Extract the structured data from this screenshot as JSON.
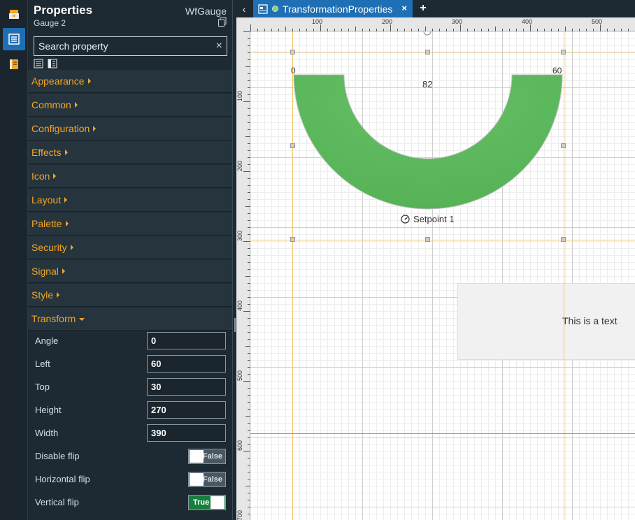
{
  "sidebar_icons": [
    {
      "name": "toolbox-icon",
      "active": false
    },
    {
      "name": "properties-icon",
      "active": true
    },
    {
      "name": "book-icon",
      "active": false
    }
  ],
  "panel": {
    "title": "Properties",
    "subtitle": "Gauge 2",
    "type": "WfGauge",
    "search_placeholder": "Search property",
    "categories": [
      "Appearance",
      "Common",
      "Configuration",
      "Effects",
      "Icon",
      "Layout",
      "Palette",
      "Security",
      "Signal",
      "Style"
    ],
    "expanded_category": "Transform",
    "transform_props": [
      {
        "label": "Angle",
        "value": "0"
      },
      {
        "label": "Left",
        "value": "60"
      },
      {
        "label": "Top",
        "value": "30"
      },
      {
        "label": "Height",
        "value": "270"
      },
      {
        "label": "Width",
        "value": "390"
      }
    ],
    "flips": [
      {
        "label": "Disable flip",
        "state": "False"
      },
      {
        "label": "Horizontal flip",
        "state": "False"
      },
      {
        "label": "Vertical flip",
        "state": "True"
      }
    ]
  },
  "tabs": {
    "active": "TransformationProperties",
    "close": "×",
    "add": "+",
    "back": "‹"
  },
  "ruler": {
    "top_labels": [
      "100",
      "200",
      "300",
      "400",
      "500"
    ],
    "left_labels": [
      "100",
      "200",
      "300",
      "400",
      "500",
      "600",
      "700"
    ]
  },
  "gauge": {
    "min": "0",
    "max": "60",
    "value": "82",
    "setpoint": "Setpoint 1",
    "color": "#5cb85c"
  },
  "canvas_text": "This is a text"
}
